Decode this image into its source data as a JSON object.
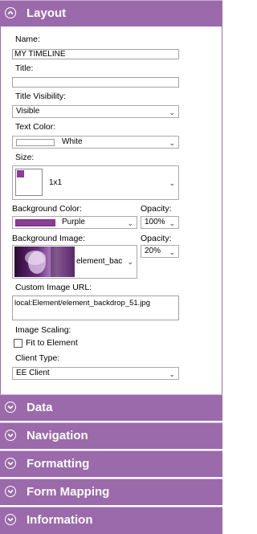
{
  "sections": {
    "layout": "Layout",
    "data": "Data",
    "navigation": "Navigation",
    "formatting": "Formatting",
    "form_mapping": "Form Mapping",
    "information": "Information"
  },
  "fields": {
    "name_label": "Name:",
    "name_value": "MY TIMELINE",
    "title_label": "Title:",
    "title_value": "",
    "title_visibility_label": "Title Visibility:",
    "title_visibility_value": "Visible",
    "text_color_label": "Text Color:",
    "text_color_value": "White",
    "text_color_hex": "#ffffff",
    "size_label": "Size:",
    "size_value": "1x1",
    "bg_color_label": "Background Color:",
    "bg_color_value": "Purple",
    "bg_color_hex": "#8b3c95",
    "opacity_label": "Opacity:",
    "opacity_value": "100%",
    "bg_image_label": "Background Image:",
    "bg_image_value": "element_bac",
    "image_opacity_label": "Opacity:",
    "image_opacity_value": "20%",
    "custom_url_label": "Custom Image URL:",
    "custom_url_value": "local:Element/element_backdrop_51.jpg",
    "image_scaling_label": "Image Scaling:",
    "fit_to_element_label": "Fit to Element",
    "fit_to_element_checked": false,
    "client_type_label": "Client Type:",
    "client_type_value": "EE Client"
  },
  "colors": {
    "header_bg": "#9b6aaa",
    "accent": "#8b3c95"
  }
}
